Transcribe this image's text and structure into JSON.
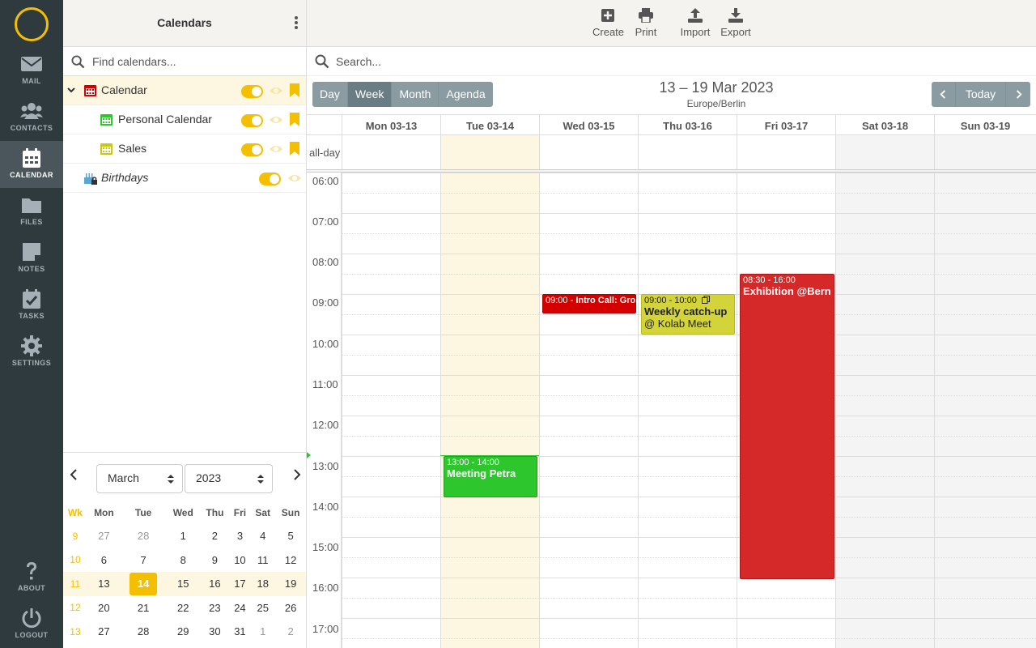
{
  "nav": [
    {
      "label": "Mail",
      "icon": "mail-icon"
    },
    {
      "label": "Contacts",
      "icon": "contacts-icon"
    },
    {
      "label": "Calendar",
      "icon": "calendar-icon",
      "active": true
    },
    {
      "label": "Files",
      "icon": "folder-icon"
    },
    {
      "label": "Notes",
      "icon": "notes-icon"
    },
    {
      "label": "Tasks",
      "icon": "tasks-icon"
    },
    {
      "label": "Settings",
      "icon": "gear-icon"
    },
    {
      "label": "About",
      "icon": "question-icon"
    },
    {
      "label": "Logout",
      "icon": "power-icon"
    }
  ],
  "sidebar": {
    "title": "Calendars",
    "find_placeholder": "Find calendars...",
    "calendars": [
      {
        "name": "Calendar",
        "color": "#d40000",
        "enabled": true
      },
      {
        "name": "Personal Calendar",
        "color": "#2dc72d",
        "enabled": true
      },
      {
        "name": "Sales",
        "color": "#c8c812",
        "enabled": true
      },
      {
        "name": "Birthdays",
        "color": "#57a8d6",
        "enabled": true
      }
    ]
  },
  "mini": {
    "month": "March",
    "year": "2023",
    "headers": [
      "Wk",
      "Mon",
      "Tue",
      "Wed",
      "Thu",
      "Fri",
      "Sat",
      "Sun"
    ],
    "weeks": [
      [
        "9",
        "27",
        "28",
        "1",
        "2",
        "3",
        "4",
        "5"
      ],
      [
        "10",
        "6",
        "7",
        "8",
        "9",
        "10",
        "11",
        "12"
      ],
      [
        "11",
        "13",
        "14",
        "15",
        "16",
        "17",
        "18",
        "19"
      ],
      [
        "12",
        "20",
        "21",
        "22",
        "23",
        "24",
        "25",
        "26"
      ],
      [
        "13",
        "27",
        "28",
        "29",
        "30",
        "31",
        "1",
        "2"
      ]
    ]
  },
  "toolbar": {
    "create": "Create",
    "print": "Print",
    "import": "Import",
    "export": "Export"
  },
  "search_placeholder": "Search...",
  "views": [
    "Day",
    "Week",
    "Month",
    "Agenda"
  ],
  "active_view": "Week",
  "range": "13 – 19 Mar 2023",
  "timezone": "Europe/Berlin",
  "today_label": "Today",
  "days": [
    "Mon 03-13",
    "Tue 03-14",
    "Wed 03-15",
    "Thu 03-16",
    "Fri 03-17",
    "Sat 03-18",
    "Sun 03-19"
  ],
  "allday_label": "all-day",
  "hours": [
    "06:00",
    "07:00",
    "08:00",
    "09:00",
    "10:00",
    "11:00",
    "12:00",
    "13:00",
    "14:00",
    "15:00",
    "16:00",
    "17:00"
  ],
  "events": [
    {
      "time": "09:00 - ",
      "title": "Intro Call: Grow",
      "color": "#d40000"
    },
    {
      "time": "09:00 - 10:00",
      "title": "Weekly catch-up",
      "location": "@ Kolab Meet",
      "color": "#d3d33a"
    },
    {
      "time": "08:30 - 16:00",
      "title": "Exhibition @Bern",
      "color": "#d52828"
    },
    {
      "time": "13:00 - 14:00",
      "title": "Meeting Petra",
      "color": "#2dc72d"
    }
  ]
}
